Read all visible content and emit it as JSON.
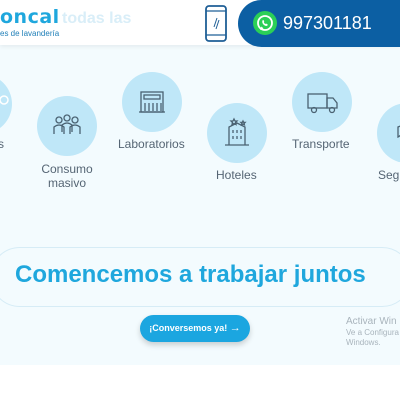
{
  "header": {
    "logo_text": "oncal",
    "logo_tagline": "es de lavandería",
    "ghost_text": "todas las",
    "phone_icon": "mobile-phone-icon",
    "whatsapp_icon": "whatsapp-icon",
    "phone_number": "997301181",
    "colors": {
      "brand": "#1fa7dd",
      "bar": "#0c5fa3",
      "whatsapp": "#2bcf57"
    }
  },
  "categories": [
    {
      "label": "s",
      "icon": "partial-icon"
    },
    {
      "label": "Consumo\nmasivo",
      "icon": "people-group-icon"
    },
    {
      "label": "Laboratorios",
      "icon": "laboratory-building-icon"
    },
    {
      "label": "Hoteles",
      "icon": "hotel-building-icon"
    },
    {
      "label": "Transporte",
      "icon": "truck-icon"
    },
    {
      "label": "Seg",
      "icon": "shield-icon"
    }
  ],
  "cta": {
    "title": "Comencemos a trabajar juntos",
    "button_label": "¡Conversemos ya!",
    "button_arrow": "→"
  },
  "watermark": {
    "title": "Activar Win",
    "line1": "Ve a Configura",
    "line2": "Windows."
  }
}
